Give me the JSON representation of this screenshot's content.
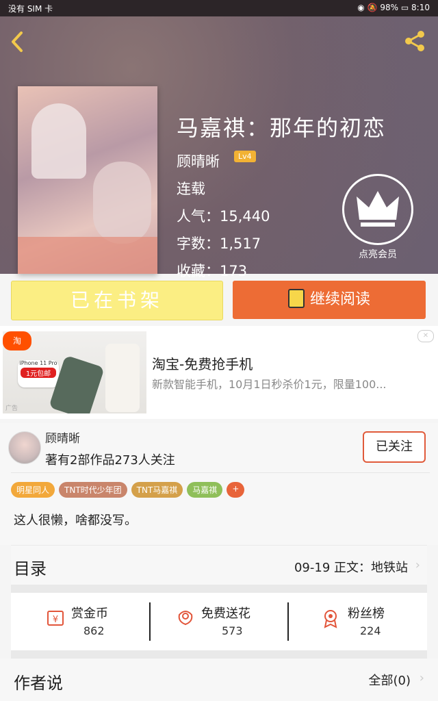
{
  "status_bar": {
    "left": "没有 SIM 卡",
    "battery": "98%",
    "time": "8:10"
  },
  "book": {
    "title": "马嘉祺：那年的初恋",
    "author": "顾晴晰",
    "level": "Lv4",
    "status": "连载",
    "popularity_label": "人气",
    "popularity": "15,440",
    "words_label": "字数",
    "words": "1,517",
    "favorites_label": "收藏",
    "favorites": "173",
    "vip_label": "点亮会员"
  },
  "actions": {
    "shelf_label": "已在书架",
    "read_label": "继续阅读"
  },
  "ad": {
    "title": "淘宝-免费抢手机",
    "desc": "新款智能手机，10月1日秒杀价1元，限量100...",
    "tag": "淘",
    "phone_text": "iPhone 11 Pro",
    "promo": "1元包邮",
    "ad_mark": "广告"
  },
  "author_info": {
    "name": "顾晴晰",
    "works": "著有2部作品273人关注",
    "follow_label": "已关注",
    "tags": [
      {
        "label": "明星同人",
        "color": "#f2a83b"
      },
      {
        "label": "TNT时代少年团",
        "color": "#c9856b"
      },
      {
        "label": "TNT马嘉祺",
        "color": "#d4a04a"
      },
      {
        "label": "马嘉祺",
        "color": "#8fbf5a"
      },
      {
        "label": "+",
        "color": "#e8643a"
      }
    ],
    "bio": "这人很懒，啥都没写。"
  },
  "toc": {
    "label": "目录",
    "latest": "09-19 正文：地铁站"
  },
  "stats": [
    {
      "icon": "reward-coin-icon",
      "name": "赏金币",
      "value": "862"
    },
    {
      "icon": "flower-icon",
      "name": "免费送花",
      "value": "573"
    },
    {
      "icon": "medal-icon",
      "name": "粉丝榜",
      "value": "224"
    }
  ],
  "author_say": {
    "label": "作者说",
    "all": "全部(0)"
  }
}
